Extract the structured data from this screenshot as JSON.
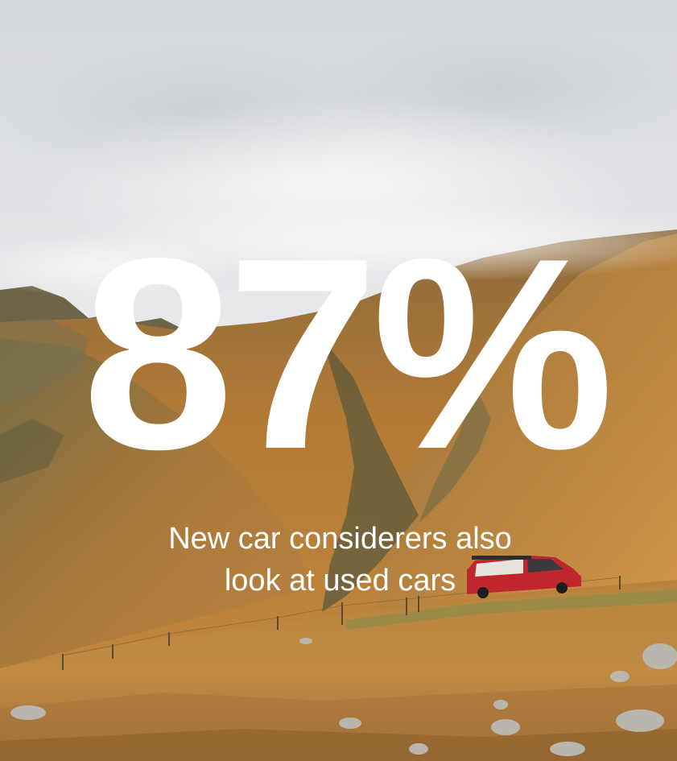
{
  "stat": {
    "value": "87%",
    "caption_line1": "New car considerers also",
    "caption_line2": "look at used cars"
  },
  "colors": {
    "text": "#ffffff",
    "sky": "#e8e9eb",
    "hillside": "#b9803a",
    "van": "#c0262d"
  }
}
